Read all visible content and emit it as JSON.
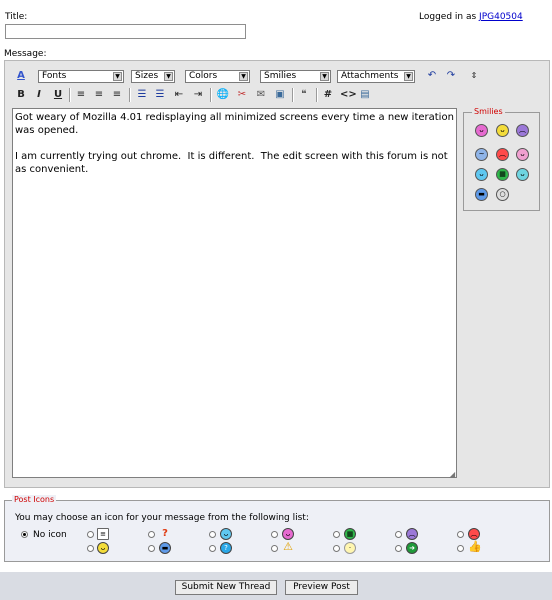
{
  "form": {
    "title_label": "Title:",
    "title_value": "",
    "logged_in_text": "Logged in as",
    "username": "JPG40504",
    "message_label": "Message:"
  },
  "toolbar": {
    "fonts": "Fonts",
    "sizes": "Sizes",
    "colors": "Colors",
    "smilies": "Smilies",
    "attachments": "Attachments",
    "bold": "B",
    "italic": "I",
    "underline": "U",
    "hash": "#",
    "code": "<>"
  },
  "message_text": "Got weary of Mozilla 4.01 redisplaying all minimized screens every time a new iteration was opened.\n\nI am currently trying out chrome.  It is different.  The edit screen with this forum is not as convenient.",
  "smilies_panel": {
    "title": "Smilies",
    "icons": [
      "smile-icon",
      "grin-icon",
      "frown-icon",
      "confused-icon",
      "mad-icon",
      "tongue-icon",
      "wink-icon",
      "biggrin-icon",
      "rolleyes-icon",
      "cool-icon",
      "eek-icon"
    ]
  },
  "post_icons": {
    "title": "Post Icons",
    "instruction": "You may choose an icon for your message from the following list:",
    "no_icon_label": "No icon",
    "selected": "no-icon"
  },
  "buttons": {
    "submit": "Submit New Thread",
    "preview": "Preview Post"
  }
}
